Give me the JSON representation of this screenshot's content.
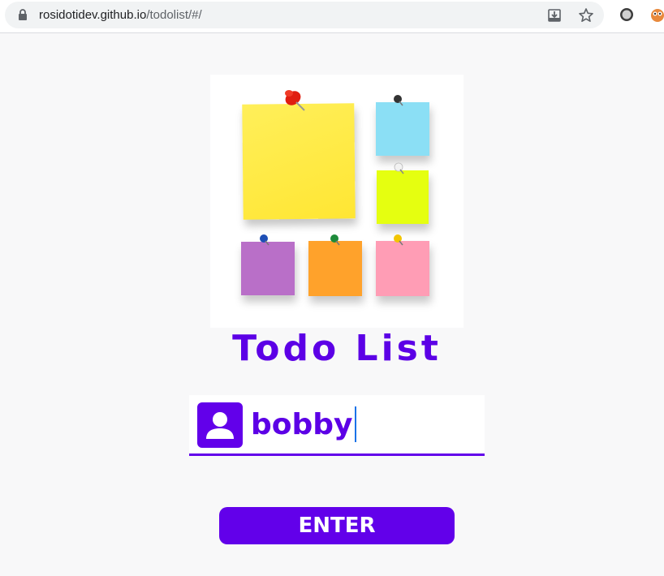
{
  "browser": {
    "url_host": "rosidotidev.github.io",
    "url_path": "/todolist/#/",
    "icons": {
      "lock": "lock-icon",
      "install": "install-app-icon",
      "bookmark": "star-icon",
      "ext1": "extension-circle-icon",
      "ext2": "extension-owl-icon"
    }
  },
  "app": {
    "hero_image": "sticky-notes-board",
    "title": "Todo List",
    "name_input": {
      "value": "bobby",
      "icon": "user-icon"
    },
    "enter_button": "ENTER"
  },
  "colors": {
    "accent": "#6200ea",
    "note_yellow": "#ffec45",
    "note_blue": "#8bdff5",
    "note_lime": "#e5ff10",
    "note_purple": "#b96fc8",
    "note_orange": "#ffa22b",
    "note_pink": "#ff9db5"
  }
}
